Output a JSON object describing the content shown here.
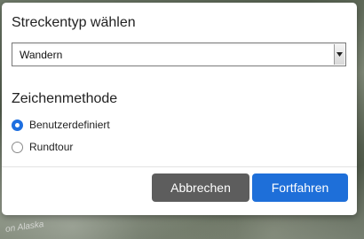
{
  "map": {
    "label": "on Alaska"
  },
  "dialog": {
    "route_type": {
      "title": "Streckentyp wählen",
      "select": {
        "value": "Wandern",
        "arrow_icon": "chevron-down-icon"
      }
    },
    "draw_method": {
      "title": "Zeichenmethode",
      "options": [
        {
          "label": "Benutzerdefiniert",
          "checked": true
        },
        {
          "label": "Rundtour",
          "checked": false
        }
      ]
    },
    "buttons": {
      "cancel_label": "Abbrechen",
      "continue_label": "Fortfahren"
    }
  },
  "colors": {
    "primary": "#1e6fd9",
    "secondary": "#5d5d5d",
    "radio_checked": "#1e6fe0"
  }
}
